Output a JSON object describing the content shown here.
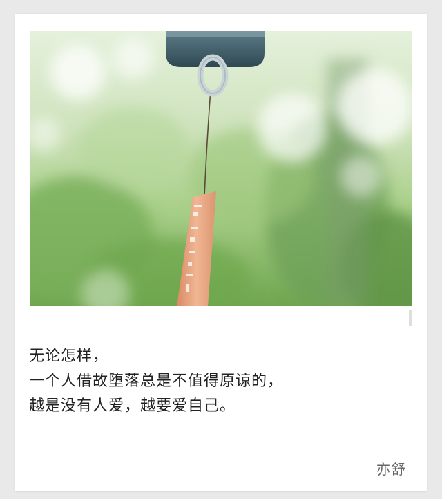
{
  "quote": {
    "lines": [
      "无论怎样，",
      "一个人借故堕落总是不值得原谅的，",
      "越是没有人爱，越要爱自己。"
    ]
  },
  "author": "亦舒",
  "photo": {
    "subject": "wind-chime-icon",
    "palette": {
      "background_light": "#dfeecb",
      "background_green": "#7eb55e",
      "chime_bell": "#3f5f6b",
      "paper_strip": "#e8a783"
    }
  }
}
